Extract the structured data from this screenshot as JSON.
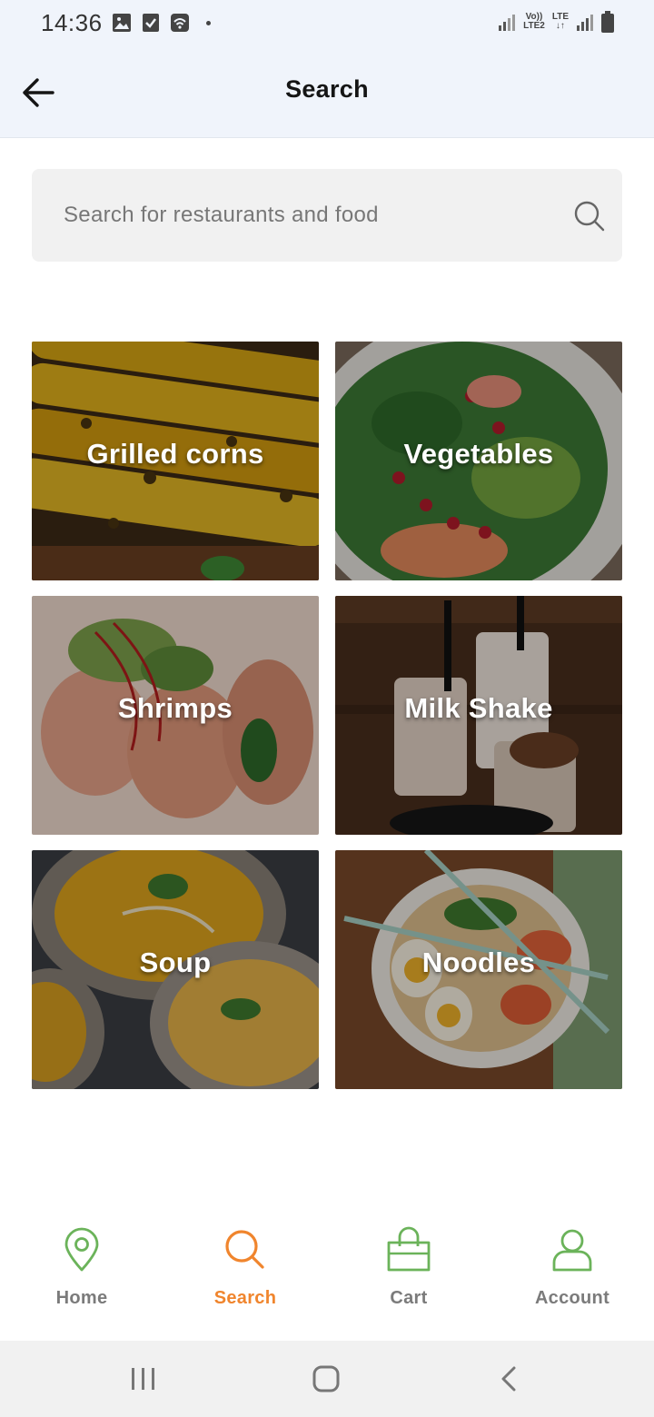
{
  "status_bar": {
    "time": "14:36",
    "network_top": "Vo))",
    "network_bottom": "LTE2",
    "lte_label": "LTE",
    "lte_arrows": "↓↑",
    "icons_left": [
      "gallery-icon",
      "checkbox-icon",
      "wifi-calling-icon"
    ],
    "icons_right": [
      "signal-icon",
      "signal-icon-2",
      "battery-icon"
    ]
  },
  "header": {
    "title": "Search",
    "back_icon": "arrow-left-icon"
  },
  "search": {
    "placeholder": "Search for restaurants and food",
    "icon": "search-icon"
  },
  "categories": [
    {
      "label": "Grilled corns"
    },
    {
      "label": "Vegetables"
    },
    {
      "label": "Shrimps"
    },
    {
      "label": "Milk Shake"
    },
    {
      "label": "Soup"
    },
    {
      "label": "Noodles"
    }
  ],
  "bottom_nav": {
    "active_color": "#f0852d",
    "icon_color": "#6bb35a",
    "items": [
      {
        "label": "Home",
        "icon": "map-pin-icon",
        "active": false
      },
      {
        "label": "Search",
        "icon": "search-icon",
        "active": true
      },
      {
        "label": "Cart",
        "icon": "shopping-bag-icon",
        "active": false
      },
      {
        "label": "Account",
        "icon": "user-icon",
        "active": false
      }
    ]
  },
  "system_nav": {
    "icons": [
      "recent-apps-icon",
      "home-icon",
      "back-icon"
    ]
  }
}
